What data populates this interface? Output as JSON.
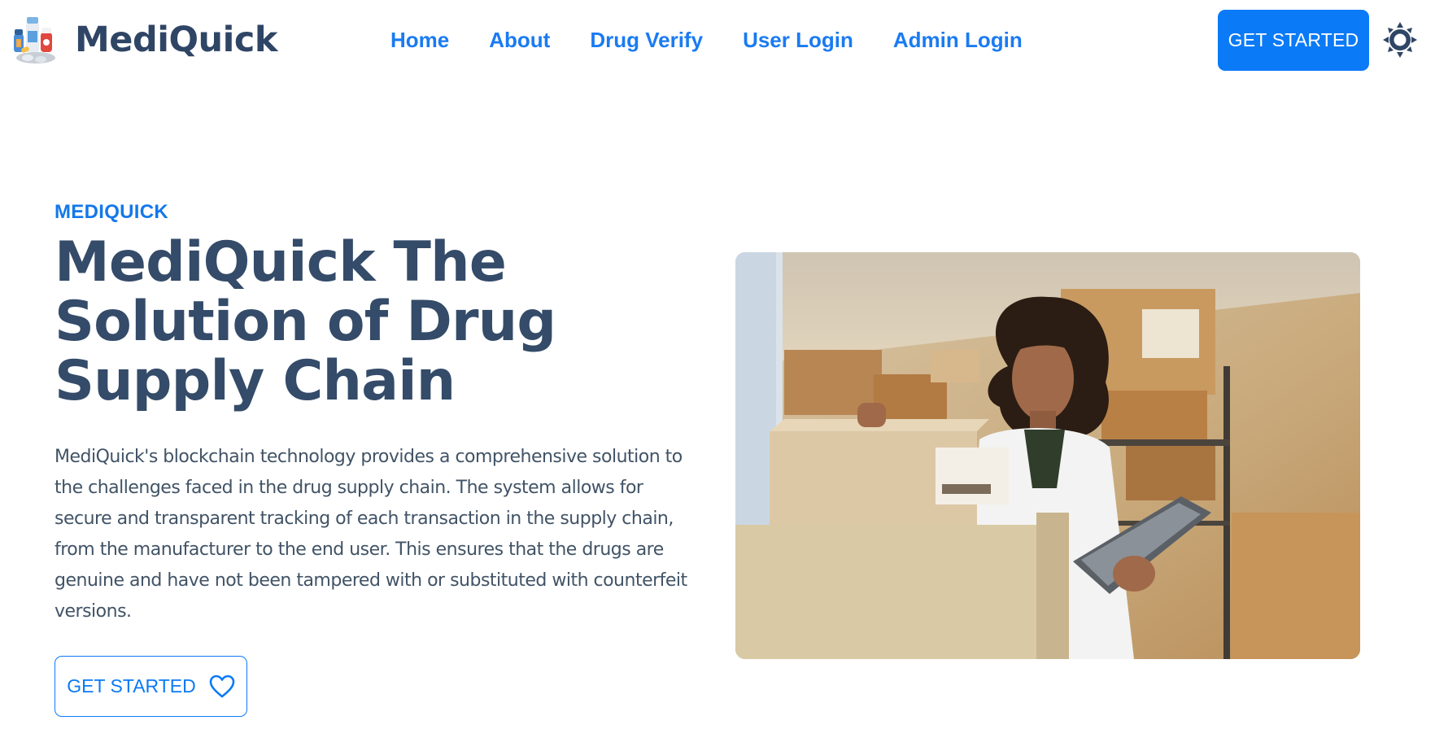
{
  "brand": {
    "name": "MediQuick",
    "logo_icon": "medicine-bottles-logo"
  },
  "nav": {
    "links": [
      {
        "label": "Home"
      },
      {
        "label": "About"
      },
      {
        "label": "Drug Verify"
      },
      {
        "label": "User Login"
      },
      {
        "label": "Admin Login"
      }
    ],
    "cta_label": "GET STARTED",
    "theme_icon": "sun-icon"
  },
  "hero": {
    "eyebrow": "MEDIQUICK",
    "title": "MediQuick The Solution of Drug Supply Chain",
    "description": "MediQuick's blockchain technology provides a comprehensive solution to the challenges faced in the drug supply chain. The system allows for secure and transparent tracking of each transaction in the supply chain, from the manufacturer to the end user. This ensures that the drugs are genuine and have not been tampered with or substituted with counterfeit versions.",
    "cta_label": "GET STARTED",
    "cta_icon": "heart-icon"
  },
  "colors": {
    "accent": "#0b7af7",
    "link": "#1a7bf2",
    "heading": "#344b69",
    "body_text": "#415366"
  }
}
